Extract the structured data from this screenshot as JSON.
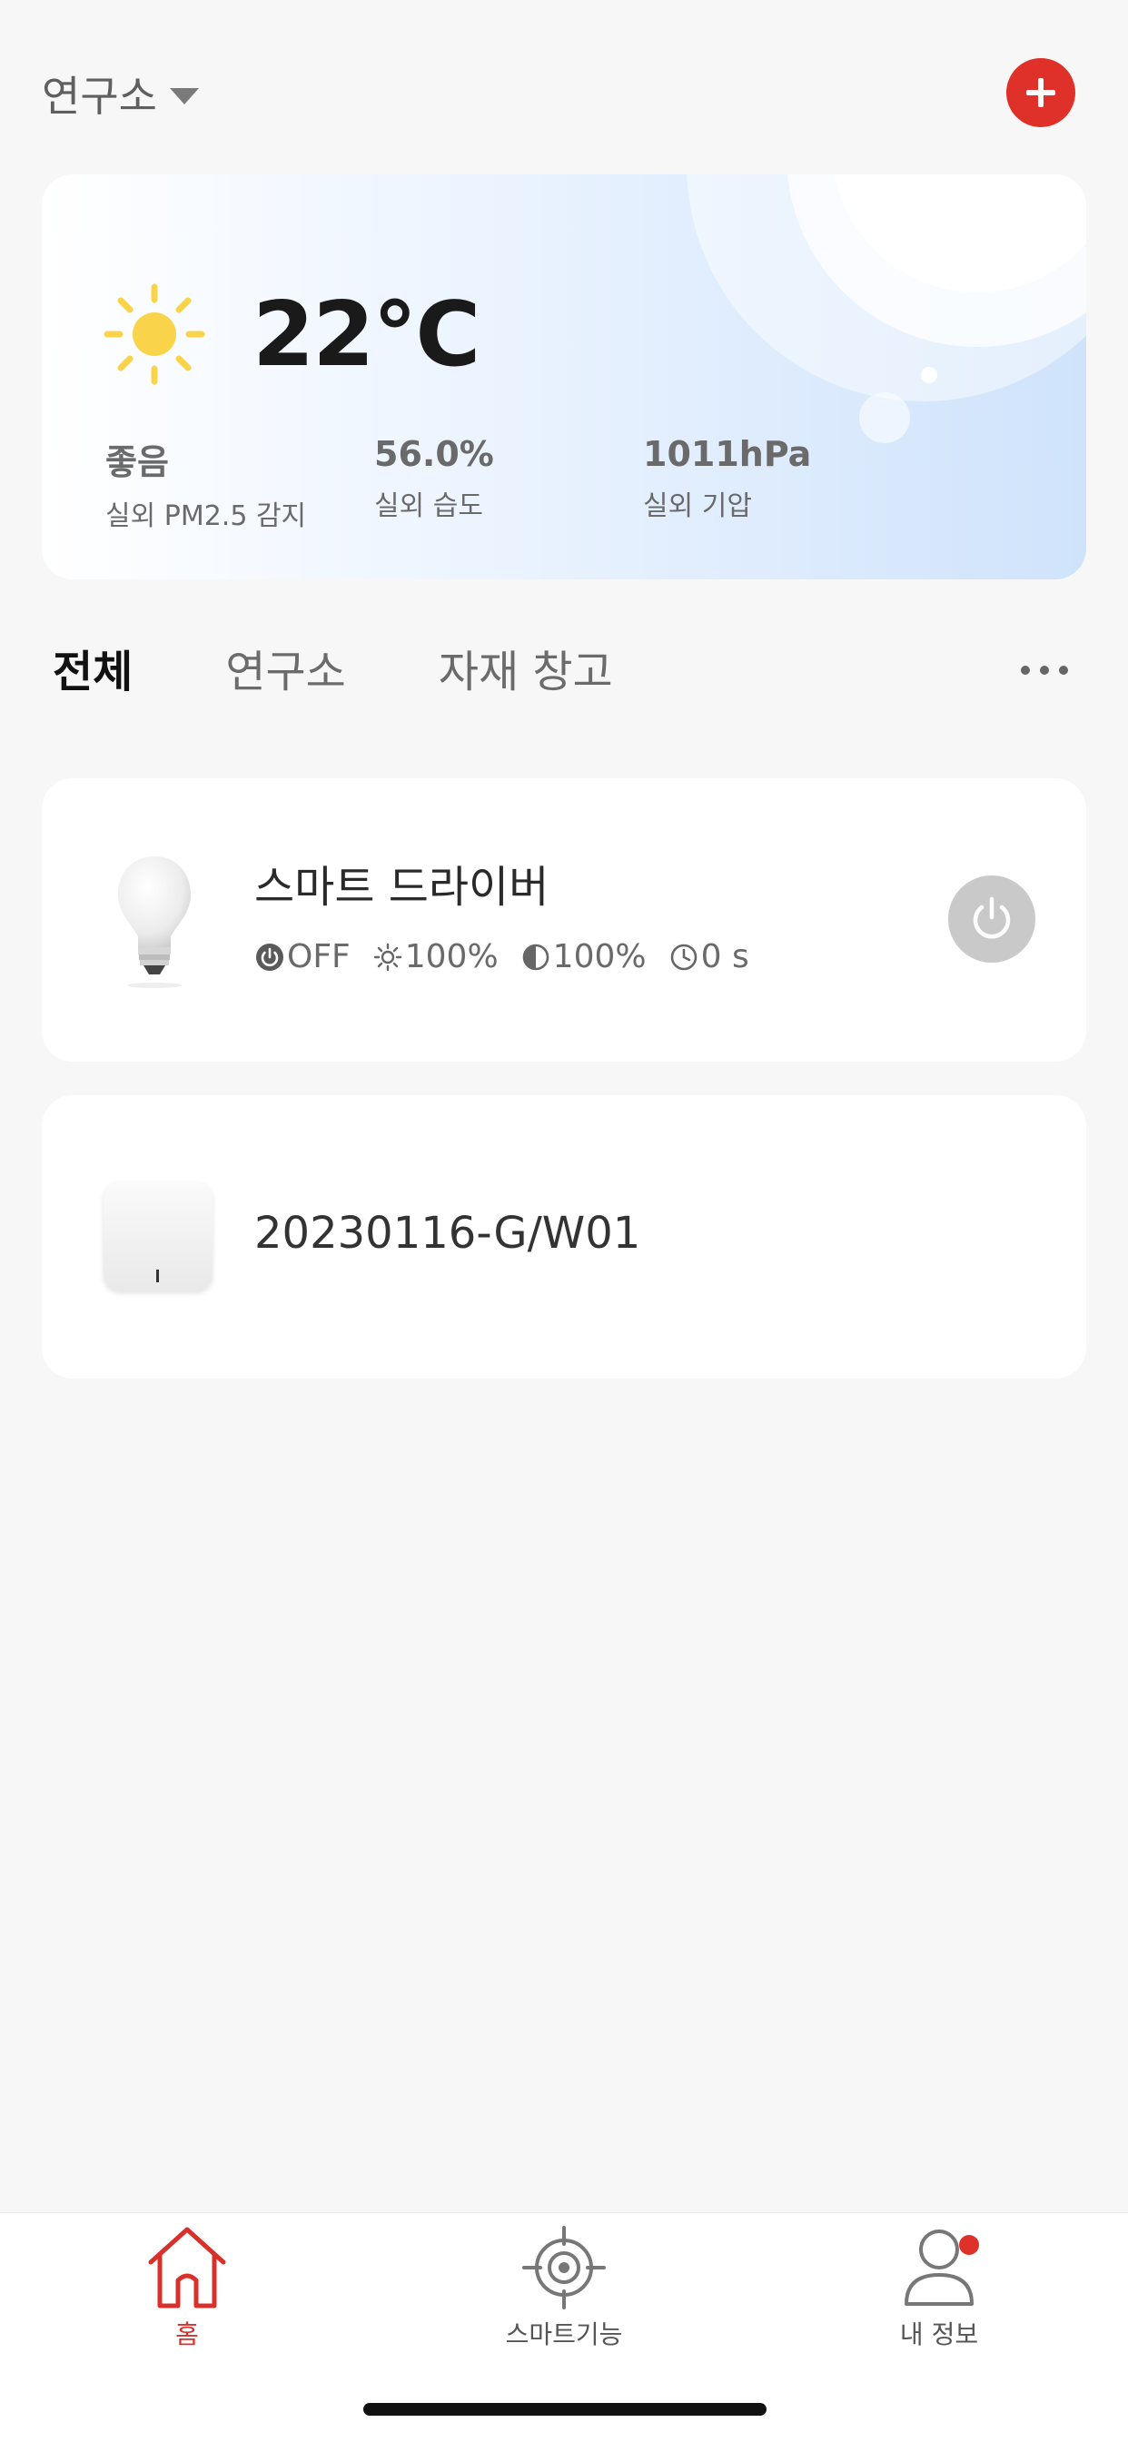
{
  "header": {
    "home_name": "연구소"
  },
  "weather": {
    "temperature": "22°C",
    "stats": [
      {
        "value": "좋음",
        "label": "실외 PM2.5 감지"
      },
      {
        "value": "56.0%",
        "label": "실외 습도"
      },
      {
        "value": "1011hPa",
        "label": "실외 기압"
      }
    ]
  },
  "tabs": [
    {
      "label": "전체",
      "active": true
    },
    {
      "label": "연구소",
      "active": false
    },
    {
      "label": "자재 창고",
      "active": false
    }
  ],
  "devices": [
    {
      "name": "스마트 드라이버",
      "status": {
        "power": "OFF",
        "brightness": "100%",
        "contrast": "100%",
        "timer": "0 s"
      }
    },
    {
      "name": "20230116-G/W01"
    }
  ],
  "bottom_nav": [
    {
      "label": "홈",
      "active": true
    },
    {
      "label": "스마트기능",
      "active": false
    },
    {
      "label": "내 정보",
      "active": false
    }
  ],
  "colors": {
    "accent": "#e0302a",
    "sun": "#f9d44a"
  }
}
